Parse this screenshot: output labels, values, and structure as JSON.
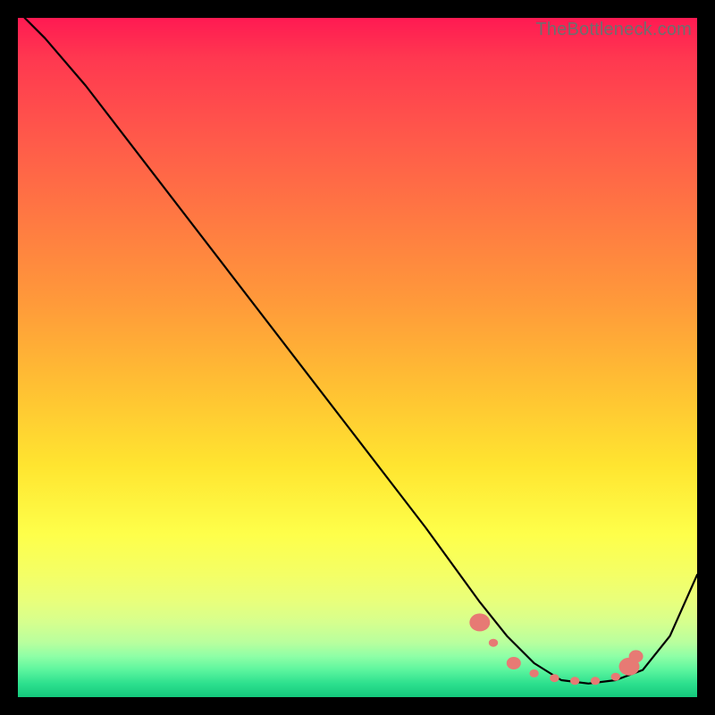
{
  "watermark": "TheBottleneck.com",
  "colors": {
    "marker": "#e77a74",
    "curve": "#000000",
    "page_bg": "#000000"
  },
  "chart_data": {
    "type": "line",
    "title": "",
    "xlabel": "",
    "ylabel": "",
    "xlim": [
      0,
      100
    ],
    "ylim": [
      0,
      100
    ],
    "note": "Axes are implicit percentage scales; values estimated from pixel positions.",
    "series": [
      {
        "name": "bottleneck-curve",
        "x": [
          1,
          4,
          10,
          20,
          30,
          40,
          50,
          60,
          68,
          72,
          76,
          80,
          84,
          88,
          92,
          96,
          100
        ],
        "y": [
          100,
          97,
          90,
          77,
          64,
          51,
          38,
          25,
          14,
          9,
          5,
          2.5,
          2,
          2.5,
          4,
          9,
          18
        ]
      }
    ],
    "markers": {
      "name": "highlight-dots",
      "points": [
        {
          "x": 68,
          "y": 11,
          "size": "large"
        },
        {
          "x": 70,
          "y": 8,
          "size": "small"
        },
        {
          "x": 73,
          "y": 5,
          "size": "medium"
        },
        {
          "x": 76,
          "y": 3.5,
          "size": "small"
        },
        {
          "x": 79,
          "y": 2.8,
          "size": "small"
        },
        {
          "x": 82,
          "y": 2.4,
          "size": "small"
        },
        {
          "x": 85,
          "y": 2.4,
          "size": "small"
        },
        {
          "x": 88,
          "y": 3.0,
          "size": "small"
        },
        {
          "x": 90,
          "y": 4.5,
          "size": "large"
        },
        {
          "x": 91,
          "y": 6.0,
          "size": "medium"
        }
      ]
    }
  }
}
